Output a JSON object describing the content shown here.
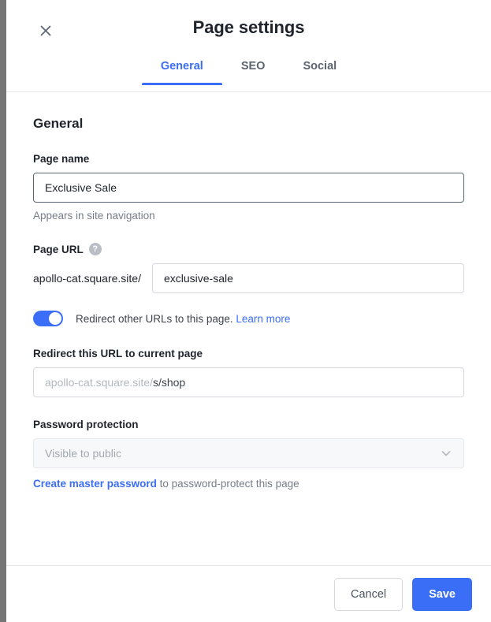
{
  "dialog": {
    "title": "Page settings",
    "close_icon": "close-icon",
    "tabs": [
      {
        "label": "General",
        "active": true
      },
      {
        "label": "SEO",
        "active": false
      },
      {
        "label": "Social",
        "active": false
      }
    ]
  },
  "general": {
    "section_title": "General",
    "page_name": {
      "label": "Page name",
      "value": "Exclusive Sale",
      "placeholder": "",
      "help_text": "Appears in site navigation"
    },
    "page_url": {
      "label": "Page URL",
      "help_icon": "question-mark-icon",
      "prefix": "apollo-cat.square.site/",
      "value": "exclusive-sale",
      "placeholder": ""
    },
    "redirect_toggle": {
      "enabled": true,
      "label": "Redirect other URLs to this page.",
      "link_label": "Learn more"
    },
    "redirect_url": {
      "label": "Redirect this URL to current page",
      "value": "",
      "placeholder_dim": "apollo-cat.square.site/",
      "placeholder_strong": "s/shop"
    },
    "password_protection": {
      "label": "Password protection",
      "selected": "Visible to public",
      "chevron_icon": "chevron-down-icon",
      "footnote_link": "Create master password",
      "footnote_rest": " to password-protect this page"
    }
  },
  "footer": {
    "cancel_label": "Cancel",
    "save_label": "Save"
  },
  "colors": {
    "accent": "#3b6ef6",
    "text": "#20242c",
    "muted": "#767d87",
    "border": "#d4d7dc"
  }
}
